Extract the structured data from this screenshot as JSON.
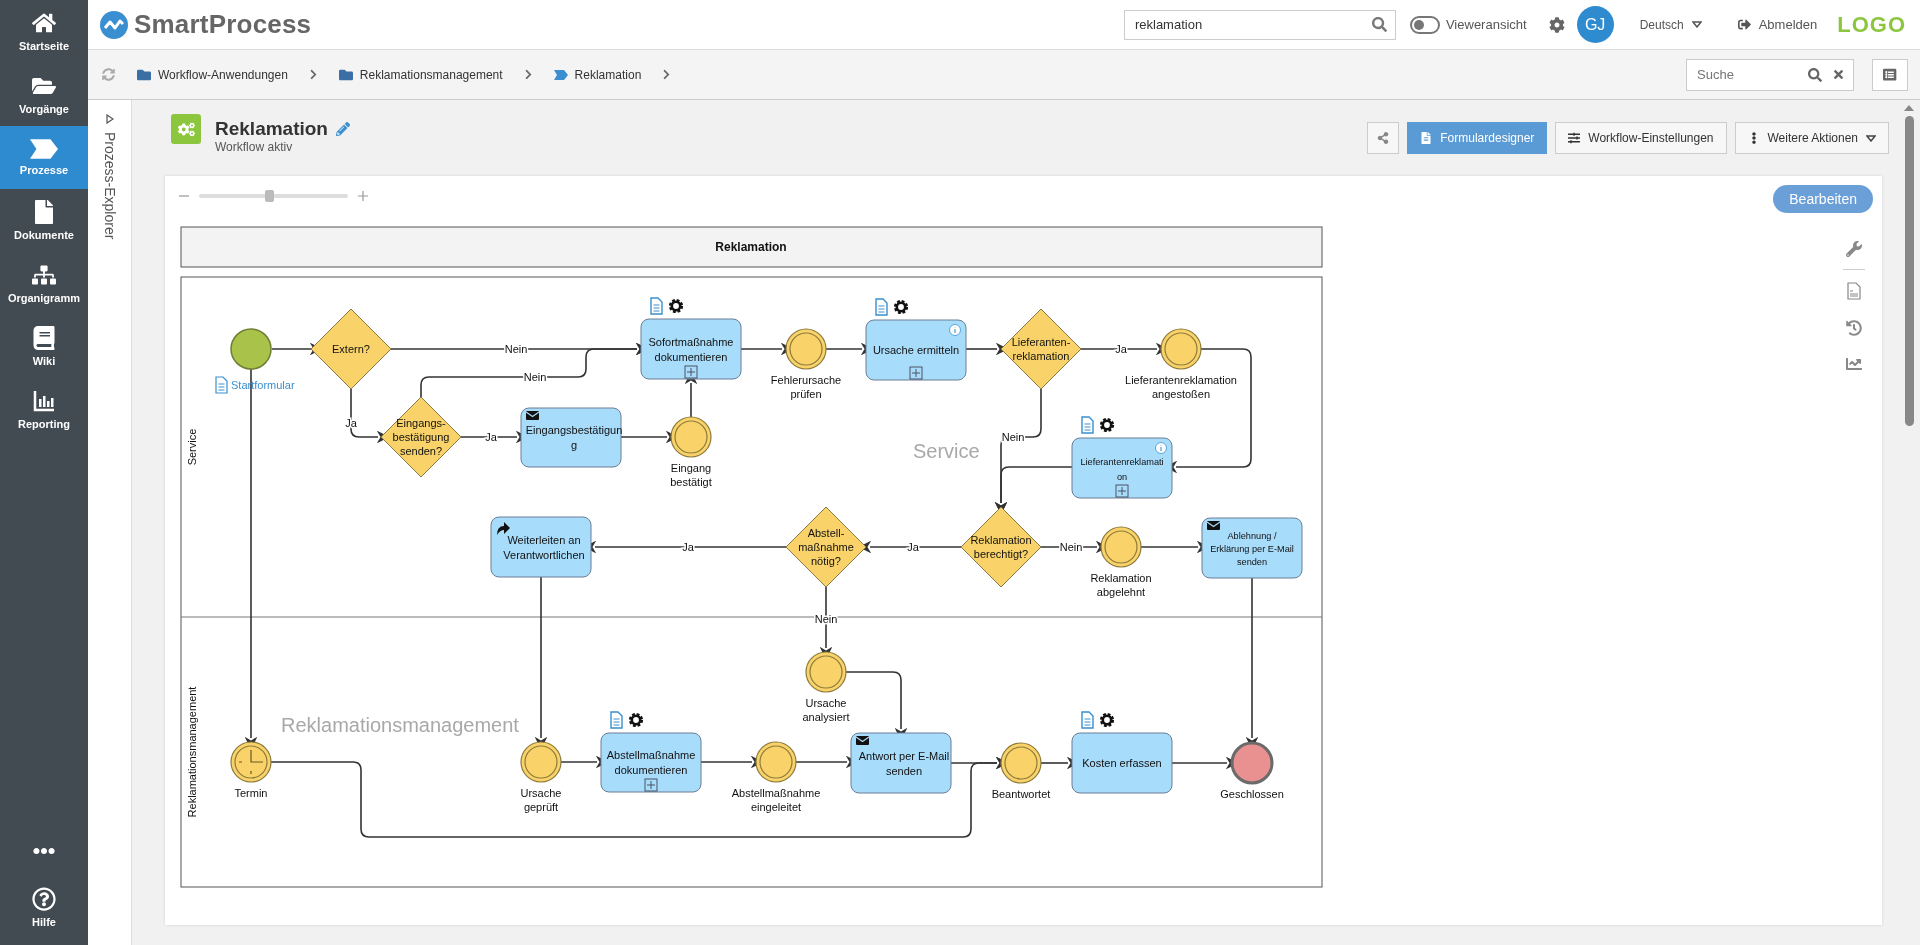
{
  "sidebar": {
    "items": [
      {
        "label": "Startseite",
        "selected": false
      },
      {
        "label": "Vorgänge",
        "selected": false
      },
      {
        "label": "Prozesse",
        "selected": true
      },
      {
        "label": "Dokumente",
        "selected": false
      },
      {
        "label": "Organigramm",
        "selected": false
      },
      {
        "label": "Wiki",
        "selected": false
      },
      {
        "label": "Reporting",
        "selected": false
      }
    ],
    "help": "Hilfe"
  },
  "topbar": {
    "brand": "SmartProcess",
    "search": {
      "value": "reklamation"
    },
    "viewer_toggle": {
      "label": "Vieweransicht",
      "on": false
    },
    "avatar": "GJ",
    "language": "Deutsch",
    "logout": "Abmelden",
    "logo": "LOGO"
  },
  "breadcrumbs": [
    {
      "label": "Workflow-Anwendungen",
      "kind": "folder"
    },
    {
      "label": "Reklamationsmanagement",
      "kind": "folder"
    },
    {
      "label": "Reklamation",
      "kind": "process"
    }
  ],
  "breadcrumb_search": {
    "placeholder": "Suche"
  },
  "explorer": {
    "label": "Prozess-Explorer"
  },
  "header": {
    "title": "Reklamation",
    "status": "Workflow aktiv"
  },
  "actions": [
    {
      "label": "Formulardesigner",
      "selected": true
    },
    {
      "label": "Workflow-Einstellungen",
      "selected": false
    },
    {
      "label": "Weitere Aktionen",
      "selected": false
    }
  ],
  "zoom": {
    "level": 0.47
  },
  "edit_button": "Bearbeiten",
  "diagram": {
    "title": "Reklamation",
    "lanes": [
      {
        "name": "Service",
        "watermark": "Service"
      },
      {
        "name": "Reklamationsmanagement",
        "watermark": "Reklamationsmanagement"
      }
    ],
    "nodes": [
      {
        "kind": "start",
        "form_link": "Startformular"
      },
      {
        "kind": "gateway",
        "lines": [
          "Extern?"
        ]
      },
      {
        "kind": "task",
        "lines": [
          "Sofortmaßnahme",
          "dokumentieren"
        ],
        "form": true,
        "service": true,
        "info": false,
        "subprocess": true
      },
      {
        "kind": "event",
        "lines": [
          "Fehlerursache",
          "prüfen"
        ]
      },
      {
        "kind": "task",
        "lines": [
          "Ursache ermitteln"
        ],
        "form": true,
        "service": true,
        "info": true,
        "subprocess": true
      },
      {
        "kind": "gateway",
        "lines": [
          "Lieferanten-",
          "reklamation"
        ]
      },
      {
        "kind": "event",
        "lines": [
          "Lieferantenreklamation",
          "angestoßen"
        ]
      },
      {
        "kind": "gateway",
        "lines": [
          "Eingangs-",
          "bestätigung",
          "senden?"
        ]
      },
      {
        "kind": "task",
        "lines": [
          "Eingangsbestätigun",
          "g"
        ],
        "form": false,
        "service": false,
        "info": false,
        "subprocess": false
      },
      {
        "kind": "event",
        "lines": [
          "Eingang",
          "bestätigt"
        ]
      },
      {
        "kind": "task",
        "lines": [
          "Lieferantenreklamati",
          "on"
        ],
        "form": true,
        "service": true,
        "info": true,
        "subprocess": true
      },
      {
        "kind": "task",
        "lines": [
          "Weiterleiten an",
          "Verantwortlichen"
        ],
        "form": false,
        "service": false,
        "info": false,
        "subprocess": false
      },
      {
        "kind": "gateway",
        "lines": [
          "Abstell-",
          "maßnahme",
          "nötig?"
        ]
      },
      {
        "kind": "gateway",
        "lines": [
          "Reklamation",
          "berechtigt?"
        ]
      },
      {
        "kind": "event",
        "lines": [
          "Reklamation",
          "abgelehnt"
        ]
      },
      {
        "kind": "task",
        "lines": [
          "Ablehnung /",
          "Erklärung per E-Mail",
          "senden"
        ],
        "form": false,
        "service": false,
        "info": false,
        "subprocess": false
      },
      {
        "kind": "event",
        "lines": [
          "Ursache",
          "analysiert"
        ]
      },
      {
        "kind": "timer",
        "lines": [
          "Termin"
        ]
      },
      {
        "kind": "event",
        "lines": [
          "Ursache",
          "geprüft"
        ]
      },
      {
        "kind": "task",
        "lines": [
          "Abstellmaßnahme",
          "dokumentieren"
        ],
        "form": true,
        "service": true,
        "info": false,
        "subprocess": true
      },
      {
        "kind": "event",
        "lines": [
          "Abstellmaßnahme",
          "eingeleitet"
        ]
      },
      {
        "kind": "task",
        "lines": [
          "Antwort per E-Mail",
          "senden"
        ],
        "form": false,
        "service": false,
        "info": false,
        "subprocess": false
      },
      {
        "kind": "event",
        "lines": [
          "Beantwortet"
        ]
      },
      {
        "kind": "task",
        "lines": [
          "Kosten erfassen"
        ],
        "form": true,
        "service": true,
        "info": false,
        "subprocess": false
      },
      {
        "kind": "end",
        "lines": [
          "Geschlossen"
        ]
      }
    ],
    "flow_labels": [
      "Nein",
      "Ja",
      "Nein",
      "Ja",
      "Ja",
      "Nein",
      "Ja",
      "Ja",
      "Nein",
      "Nein"
    ]
  }
}
